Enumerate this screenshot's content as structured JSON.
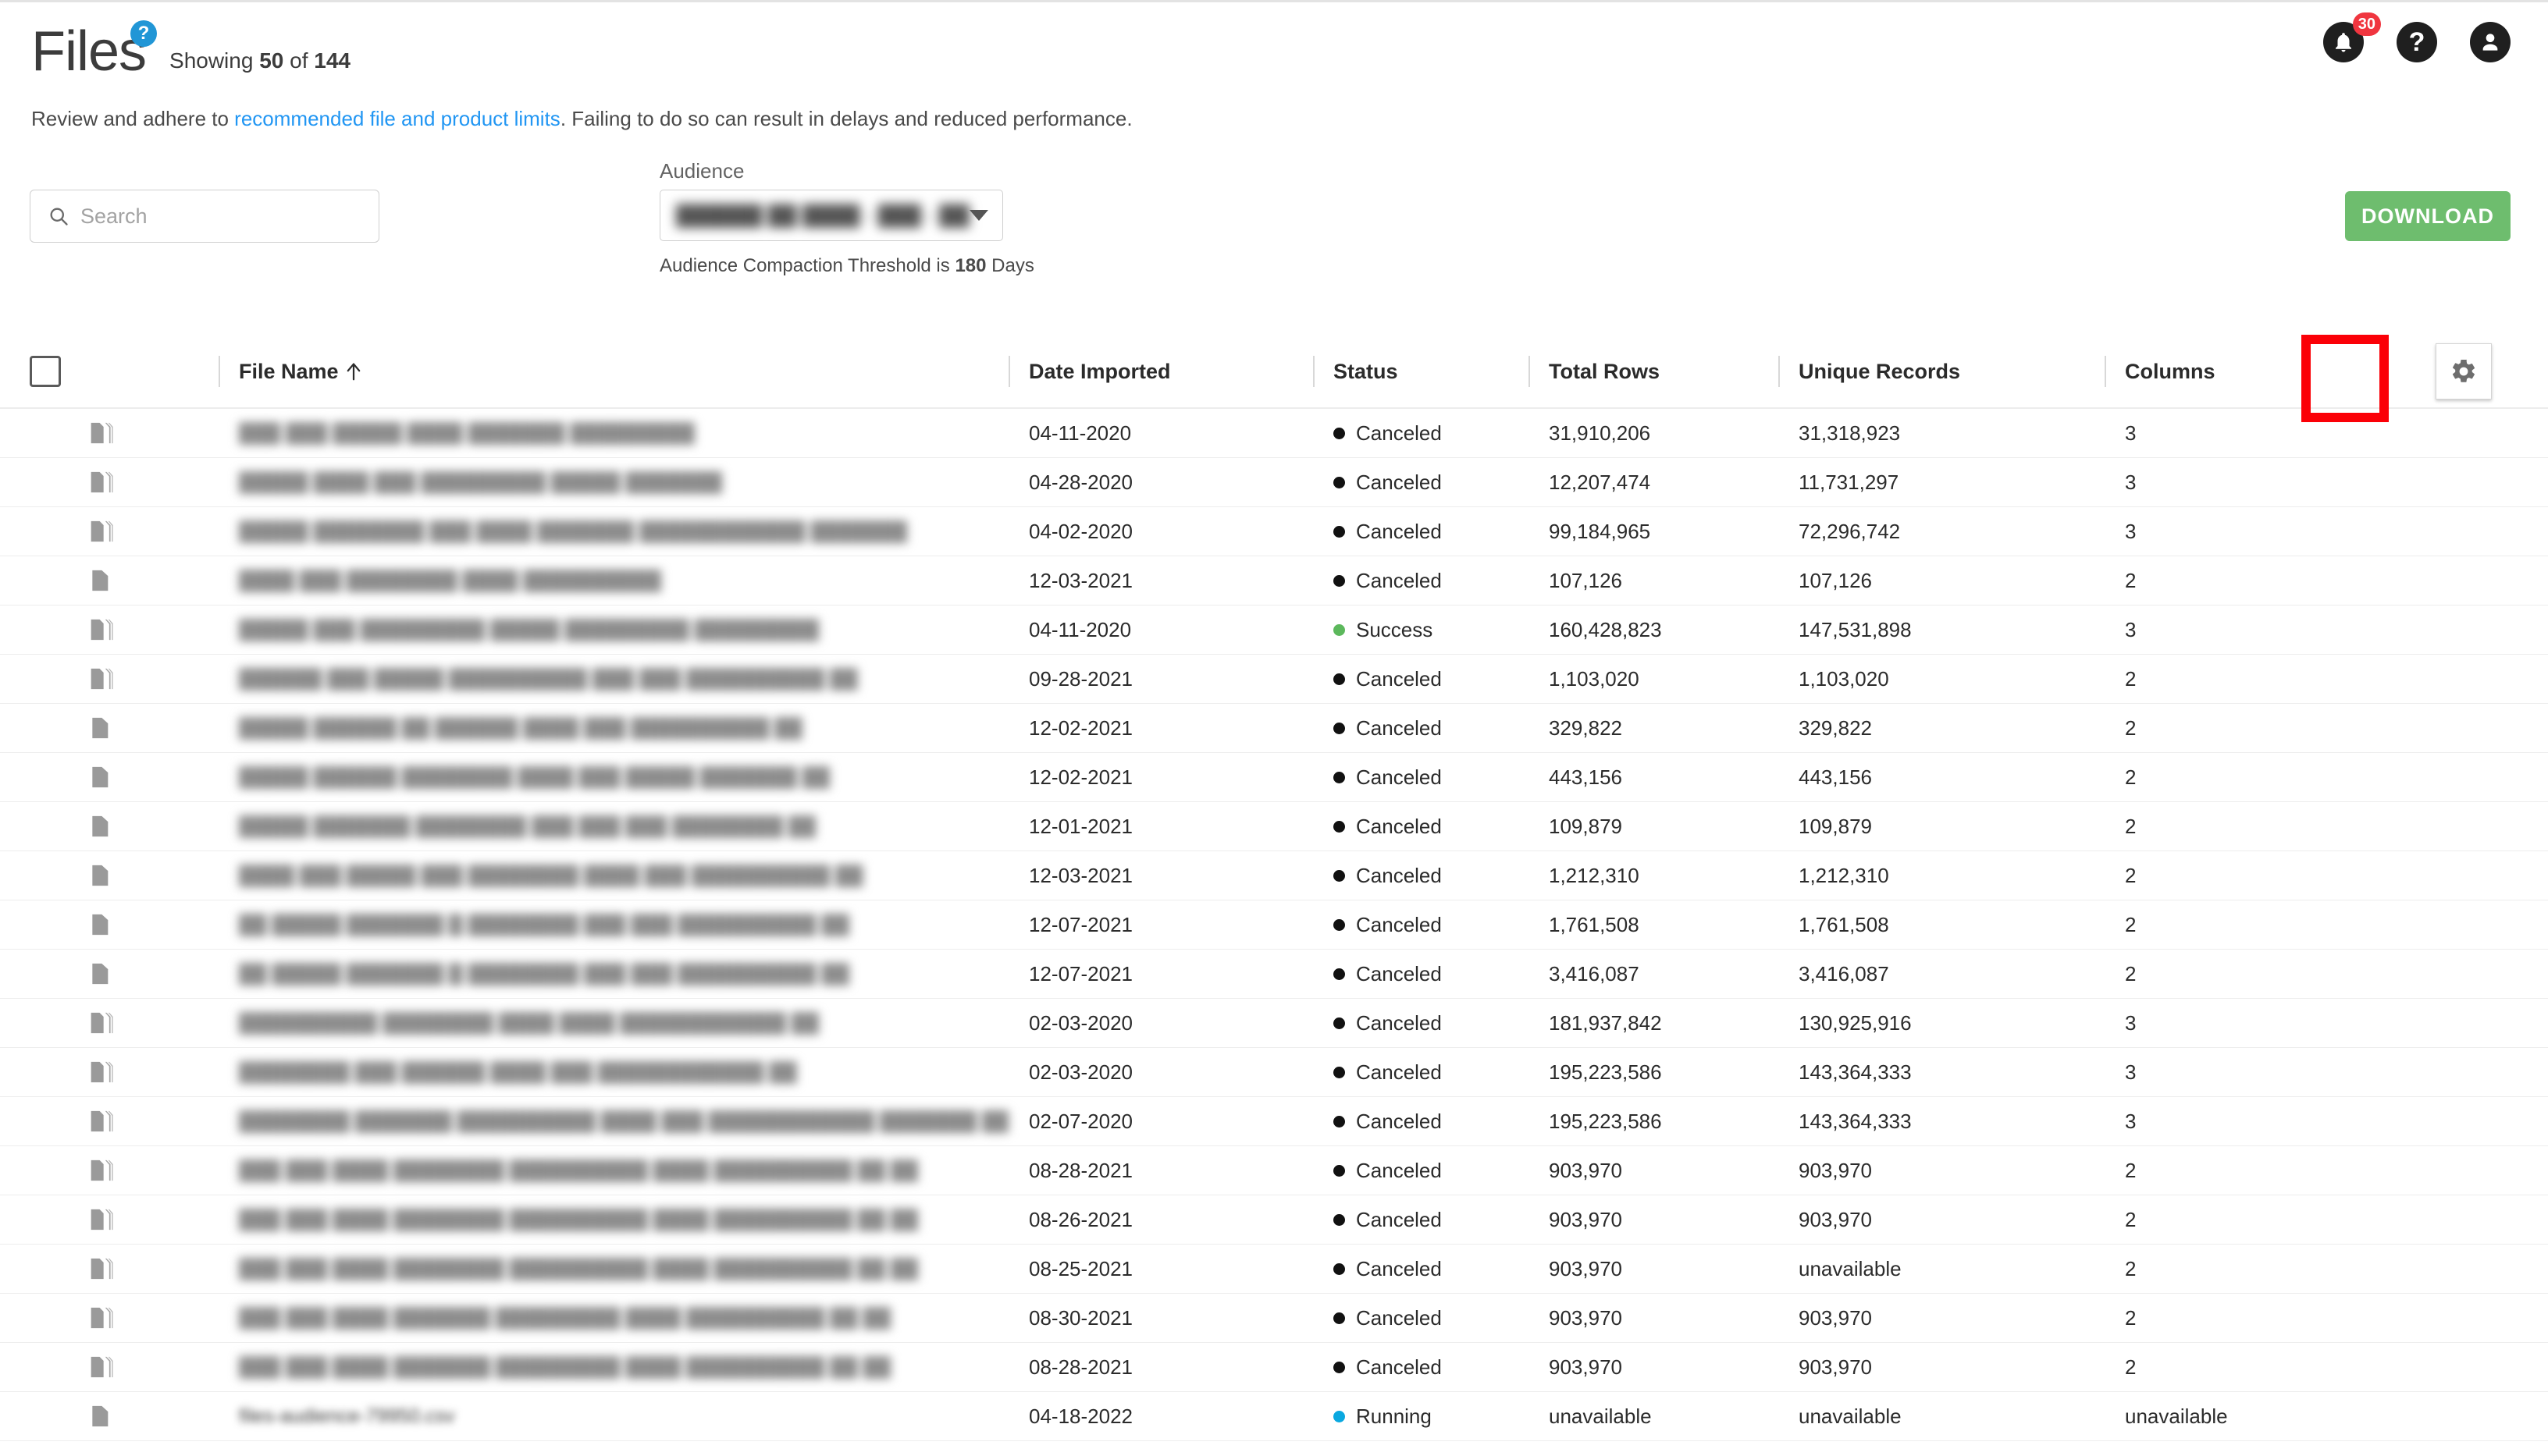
{
  "header": {
    "title": "Files",
    "help_badge": "?",
    "showing_prefix": "Showing",
    "showing_count": "50",
    "showing_middle": "of",
    "showing_total": "144",
    "subtitle_before": "Review and adhere to ",
    "subtitle_link": "recommended file and product limits",
    "subtitle_after": ". Failing to do so can result in delays and reduced performance.",
    "icons": {
      "notifications_badge": "30",
      "help_label": "?"
    }
  },
  "controls": {
    "search_placeholder": "Search",
    "search_value": "",
    "audience_label": "Audience",
    "audience_value": "██████ ██ ████ - ███ - ███ ██ ..",
    "audience_note_before": "Audience Compaction Threshold is ",
    "audience_note_value": "180",
    "audience_note_after": " Days",
    "download_label": "DOWNLOAD"
  },
  "colors": {
    "accent_link": "#2196f3",
    "badge_blue": "#2196d6",
    "download_green": "#6ebd6e",
    "status_canceled": "#111111",
    "status_success": "#5cb85c",
    "status_running": "#0aa8e0",
    "notification_red": "#f0353f",
    "highlight_red": "#fb0007"
  },
  "table": {
    "columns": [
      "File Name",
      "Date Imported",
      "Status",
      "Total Rows",
      "Unique Records",
      "Columns"
    ],
    "sort_column": "File Name",
    "sort_direction": "asc",
    "select_all_checked": false,
    "settings_label": "gear",
    "rows": [
      {
        "icon": "multi",
        "file_name": "███ ███ █████ ████ ███████ █████████",
        "date": "04-11-2020",
        "status": "Canceled",
        "status_color": "canceled",
        "total_rows": "31,910,206",
        "unique_records": "31,318,923",
        "columns": "3"
      },
      {
        "icon": "multi",
        "file_name": "█████ ████ ███ █████████ █████ ███████",
        "date": "04-28-2020",
        "status": "Canceled",
        "status_color": "canceled",
        "total_rows": "12,207,474",
        "unique_records": "11,731,297",
        "columns": "3"
      },
      {
        "icon": "multi",
        "file_name": "█████ ████████ ███ ████ ███████ ████████████ ███████",
        "date": "04-02-2020",
        "status": "Canceled",
        "status_color": "canceled",
        "total_rows": "99,184,965",
        "unique_records": "72,296,742",
        "columns": "3"
      },
      {
        "icon": "single",
        "file_name": "████ ███ ████████ ████ ██████████",
        "date": "12-03-2021",
        "status": "Canceled",
        "status_color": "canceled",
        "total_rows": "107,126",
        "unique_records": "107,126",
        "columns": "2"
      },
      {
        "icon": "multi",
        "file_name": "█████ ███ █████████ █████ █████████ █████████",
        "date": "04-11-2020",
        "status": "Success",
        "status_color": "success",
        "total_rows": "160,428,823",
        "unique_records": "147,531,898",
        "columns": "3"
      },
      {
        "icon": "multi",
        "file_name": "██████ ███ █████ ██████████ ███ ███ ██████████ ██",
        "date": "09-28-2021",
        "status": "Canceled",
        "status_color": "canceled",
        "total_rows": "1,103,020",
        "unique_records": "1,103,020",
        "columns": "2"
      },
      {
        "icon": "single",
        "file_name": "█████ ██████ ██ ██████ ████ ███ ██████████ ██",
        "date": "12-02-2021",
        "status": "Canceled",
        "status_color": "canceled",
        "total_rows": "329,822",
        "unique_records": "329,822",
        "columns": "2"
      },
      {
        "icon": "single",
        "file_name": "█████ ██████ ████████ ████ ███ █████ ███████ ██",
        "date": "12-02-2021",
        "status": "Canceled",
        "status_color": "canceled",
        "total_rows": "443,156",
        "unique_records": "443,156",
        "columns": "2"
      },
      {
        "icon": "single",
        "file_name": "█████ ███████ ████████ ███ ███ ███ ████████ ██",
        "date": "12-01-2021",
        "status": "Canceled",
        "status_color": "canceled",
        "total_rows": "109,879",
        "unique_records": "109,879",
        "columns": "2"
      },
      {
        "icon": "single",
        "file_name": "████ ███ █████ ███ ████████ ████ ███ ██████████ ██",
        "date": "12-03-2021",
        "status": "Canceled",
        "status_color": "canceled",
        "total_rows": "1,212,310",
        "unique_records": "1,212,310",
        "columns": "2"
      },
      {
        "icon": "single",
        "file_name": "██ █████ ███████ █ ████████ ███ ███ ██████████ ██",
        "date": "12-07-2021",
        "status": "Canceled",
        "status_color": "canceled",
        "total_rows": "1,761,508",
        "unique_records": "1,761,508",
        "columns": "2"
      },
      {
        "icon": "single",
        "file_name": "██ █████ ███████ █ ████████ ███ ███ ██████████ ██",
        "date": "12-07-2021",
        "status": "Canceled",
        "status_color": "canceled",
        "total_rows": "3,416,087",
        "unique_records": "3,416,087",
        "columns": "2"
      },
      {
        "icon": "multi",
        "file_name": "██████████ ████████ ████ ████ ████████████ ██",
        "date": "02-03-2020",
        "status": "Canceled",
        "status_color": "canceled",
        "total_rows": "181,937,842",
        "unique_records": "130,925,916",
        "columns": "3"
      },
      {
        "icon": "multi",
        "file_name": "████████ ███ ██████ ████ ███ ████████████ ██",
        "date": "02-03-2020",
        "status": "Canceled",
        "status_color": "canceled",
        "total_rows": "195,223,586",
        "unique_records": "143,364,333",
        "columns": "3"
      },
      {
        "icon": "multi",
        "file_name": "████████ ███████ ██████████ ████ ███ ████████████ ███████ ██",
        "date": "02-07-2020",
        "status": "Canceled",
        "status_color": "canceled",
        "total_rows": "195,223,586",
        "unique_records": "143,364,333",
        "columns": "3"
      },
      {
        "icon": "multi",
        "file_name": "███ ███ ████ ████████ ██████████ ████ ██████████ ██ ██",
        "date": "08-28-2021",
        "status": "Canceled",
        "status_color": "canceled",
        "total_rows": "903,970",
        "unique_records": "903,970",
        "columns": "2"
      },
      {
        "icon": "multi",
        "file_name": "███ ███ ████ ████████ ██████████ ████ ██████████ ██ ██",
        "date": "08-26-2021",
        "status": "Canceled",
        "status_color": "canceled",
        "total_rows": "903,970",
        "unique_records": "903,970",
        "columns": "2"
      },
      {
        "icon": "multi",
        "file_name": "███ ███ ████ ████████ ██████████ ████ ██████████ ██ ██",
        "date": "08-25-2021",
        "status": "Canceled",
        "status_color": "canceled",
        "total_rows": "903,970",
        "unique_records": "unavailable",
        "columns": "2"
      },
      {
        "icon": "multi",
        "file_name": "███ ███ ████ ███████ █████████ ████ ██████████ ██ ██",
        "date": "08-30-2021",
        "status": "Canceled",
        "status_color": "canceled",
        "total_rows": "903,970",
        "unique_records": "903,970",
        "columns": "2"
      },
      {
        "icon": "multi",
        "file_name": "███ ███ ████ ███████ █████████ ████ ██████████ ██ ██",
        "date": "08-28-2021",
        "status": "Canceled",
        "status_color": "canceled",
        "total_rows": "903,970",
        "unique_records": "903,970",
        "columns": "2"
      },
      {
        "icon": "single",
        "file_name": "files-audience-79950.csv",
        "date": "04-18-2022",
        "status": "Running",
        "status_color": "running",
        "total_rows": "unavailable",
        "unique_records": "unavailable",
        "columns": "unavailable"
      }
    ]
  }
}
